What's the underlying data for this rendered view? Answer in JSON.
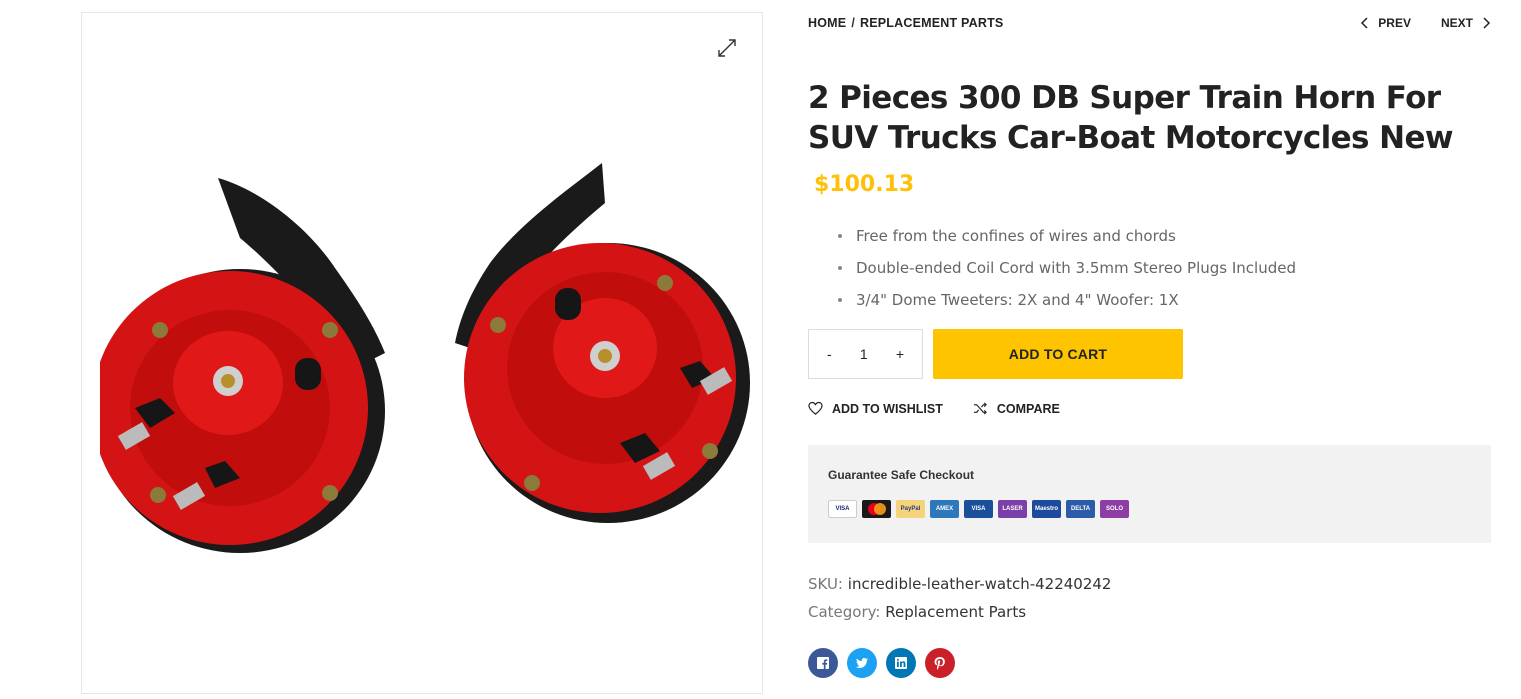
{
  "breadcrumb": {
    "home": "HOME",
    "separator": "/",
    "category": "REPLACEMENT PARTS"
  },
  "nav": {
    "prev": "PREV",
    "next": "NEXT"
  },
  "product": {
    "title": "2 Pieces 300 DB Super Train Horn For SUV Trucks Car-Boat Motorcycles New",
    "price": "$100.13",
    "features": [
      "Free from the confines of wires and chords",
      "Double-ended Coil Cord with 3.5mm Stereo Plugs Included",
      "3/4\" Dome Tweeters: 2X and 4\" Woofer: 1X"
    ]
  },
  "cart": {
    "minus": "-",
    "quantity": "1",
    "plus": "+",
    "add_to_cart": "ADD TO CART"
  },
  "actions": {
    "wishlist": "ADD TO WISHLIST",
    "compare": "COMPARE"
  },
  "checkout": {
    "title": "Guarantee Safe Checkout",
    "cards": [
      {
        "name": "visa",
        "label": "VISA",
        "color": "#ffffff",
        "text": "#1a1f71"
      },
      {
        "name": "mastercard",
        "label": "",
        "color": "#1a1a1a",
        "text": "#ffffff"
      },
      {
        "name": "paypal",
        "label": "PayPal",
        "color": "#f5d37a",
        "text": "#253b80"
      },
      {
        "name": "american-express",
        "label": "AMEX",
        "color": "#2e77bb",
        "text": "#ffffff"
      },
      {
        "name": "visa-electron",
        "label": "VISA",
        "color": "#1a4f9c",
        "text": "#ffffff"
      },
      {
        "name": "laser",
        "label": "LASER",
        "color": "#7b3fa8",
        "text": "#ffffff"
      },
      {
        "name": "maestro",
        "label": "Maestro",
        "color": "#1c4a9c",
        "text": "#ffffff"
      },
      {
        "name": "delta",
        "label": "DELTA",
        "color": "#2a5ca8",
        "text": "#ffffff"
      },
      {
        "name": "solo",
        "label": "SOLO",
        "color": "#8e3da5",
        "text": "#ffffff"
      }
    ]
  },
  "meta": {
    "sku_label": "SKU:",
    "sku": "incredible-leather-watch-42240242",
    "category_label": "Category:",
    "category": "Replacement Parts"
  },
  "social": [
    {
      "name": "facebook",
      "color": "#3b5998"
    },
    {
      "name": "twitter",
      "color": "#1da1f2"
    },
    {
      "name": "linkedin",
      "color": "#0077b5"
    },
    {
      "name": "pinterest",
      "color": "#cb2027"
    }
  ]
}
